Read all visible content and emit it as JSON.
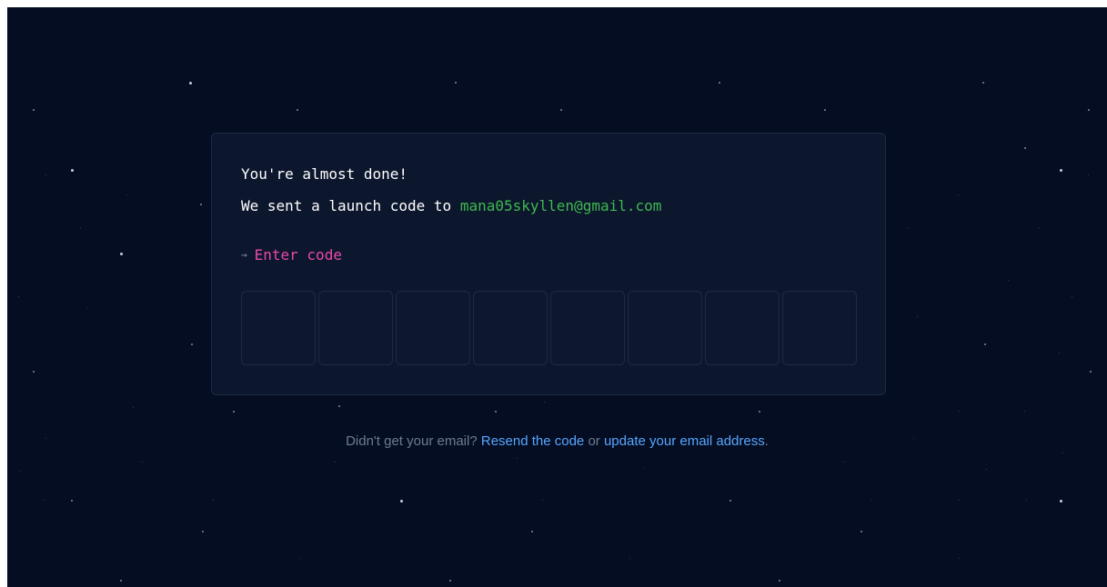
{
  "card": {
    "heading": "You're almost done!",
    "sent_prefix": "We sent a launch code to ",
    "email": "mana05skyllen@gmail.com",
    "prompt_arrow": "→",
    "prompt_label": "Enter code",
    "code_digits": [
      "",
      "",
      "",
      "",
      "",
      "",
      "",
      ""
    ]
  },
  "help": {
    "question": "Didn't get your email? ",
    "resend_link": "Resend the code",
    "or_text": " or ",
    "update_link": "update your email address",
    "period": "."
  },
  "colors": {
    "background": "#040d21",
    "card_background": "#0c162d",
    "email": "#3fb950",
    "prompt": "#ea4aaa",
    "link": "#58a6ff",
    "muted_text": "#6e7b95"
  }
}
